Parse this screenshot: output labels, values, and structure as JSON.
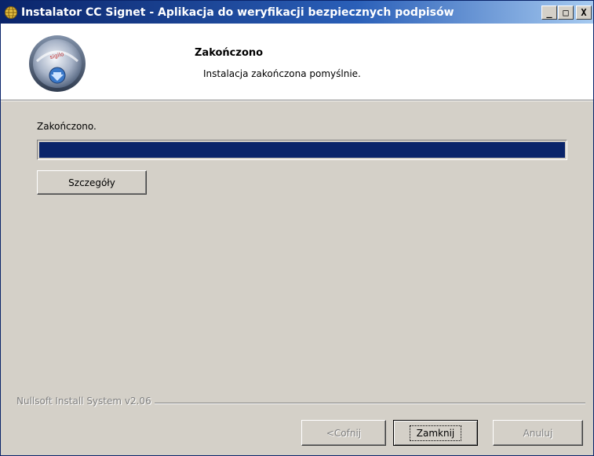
{
  "window": {
    "title": "Instalator CC Signet - Aplikacja do weryfikacji bezpiecznych podpisów",
    "minimize_label": "_",
    "maximize_label": "□",
    "close_label": "X"
  },
  "header": {
    "title": "Zakończono",
    "subtitle": "Instalacja zakończona pomyślnie."
  },
  "body": {
    "status_text": "Zakończono.",
    "progress": 1.0,
    "details_button": "Szczegóły"
  },
  "footer": {
    "branding": "Nullsoft Install System v2.06",
    "back_button": "<Cofnij",
    "close_button": "Zamknij",
    "cancel_button": "Anuluj"
  },
  "colors": {
    "titlebar_start": "#0a246a",
    "titlebar_end": "#a6caf0",
    "progress_fill": "#0a246a",
    "dialog_face": "#d4d0c8"
  },
  "icons": {
    "app": "installer-globe-icon",
    "header_logo": "disc-download-icon"
  }
}
